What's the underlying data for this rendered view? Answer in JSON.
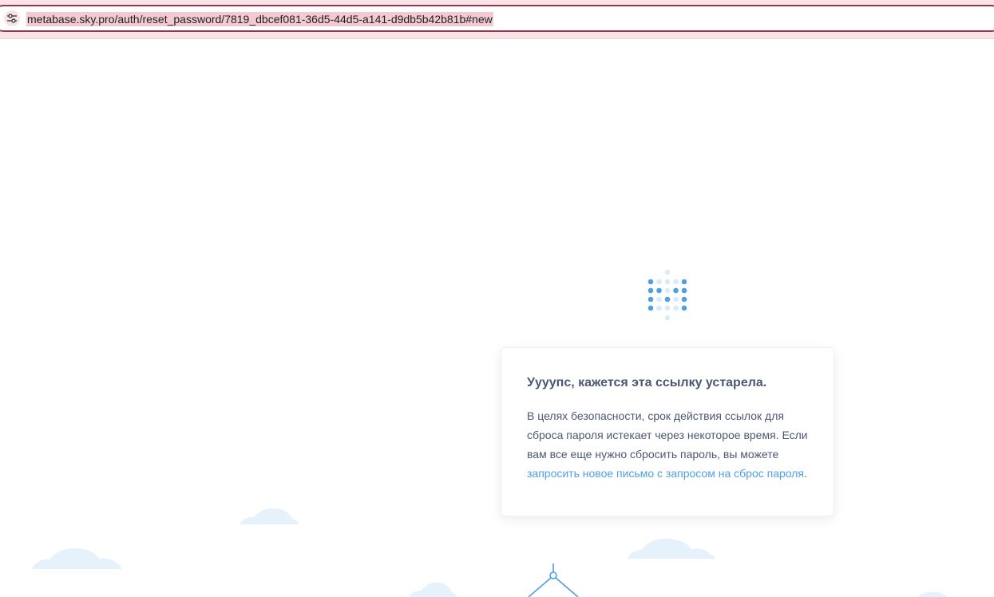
{
  "browser": {
    "url": "metabase.sky.pro/auth/reset_password/7819_dbcef081-36d5-44d5-a141-d9db5b42b81b#new",
    "site_info_icon": "tune-icon",
    "accent_color": "#8c3b4f"
  },
  "logo": {
    "icon": "metabase-logo-icon",
    "color": "#509ee3"
  },
  "card": {
    "title": "Уууупс, кажется эта ссылку устарела.",
    "body_text": "В целях безопасности, срок действия ссылок для сброса пароля истекает через некоторое время. Если вам все еще нужно сбросить пароль, вы можете",
    "link_text": "запросить новое письмо с запросом на сброс пароля",
    "link_suffix": ".",
    "text_color": "#4c5773",
    "link_color": "#509ee3"
  },
  "scenery": {
    "cloud_color": "#e5f2fc",
    "line_color": "#509ee3"
  }
}
